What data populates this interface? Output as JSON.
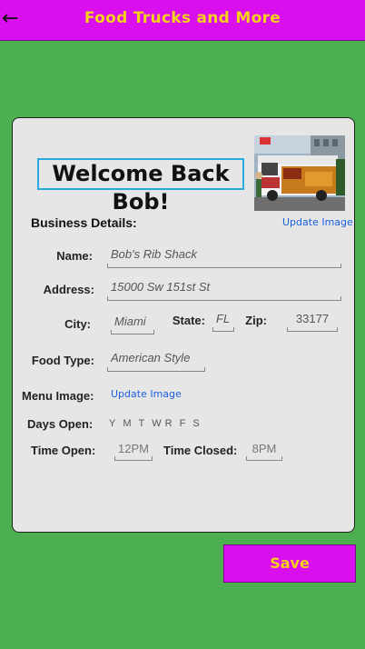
{
  "header": {
    "back_icon": "arrow-left-icon",
    "title": "Food Trucks and More"
  },
  "welcome": {
    "text": "Welcome Back Bob!"
  },
  "photo": {
    "update_label": "Update Image"
  },
  "business": {
    "section_title": "Business Details:",
    "name_label": "Name:",
    "name_value": "Bob's Rib Shack",
    "address_label": "Address:",
    "address_value": "15000 Sw 151st St",
    "city_label": "City:",
    "city_value": "Miami",
    "state_label": "State:",
    "state_value": "FL",
    "zip_label": "Zip:",
    "zip_value": "33177",
    "food_type_label": "Food Type:",
    "food_type_value": "American Style",
    "menu_image_label": "Menu Image:",
    "menu_image_update": "Update Image",
    "days_open_label": "Days Open:",
    "days": [
      "Y",
      "M",
      "T",
      "W",
      "R",
      "F",
      "S"
    ],
    "time_open_label": "Time Open:",
    "time_open_value": "12PM",
    "time_closed_label": "Time Closed:",
    "time_closed_value": "8PM"
  },
  "actions": {
    "save_label": "Save"
  },
  "colors": {
    "background": "#4caf50",
    "header": "#d90ff0",
    "accent_text": "#f3d21a",
    "link": "#1a5fe0",
    "welcome_border": "#29abe2"
  }
}
